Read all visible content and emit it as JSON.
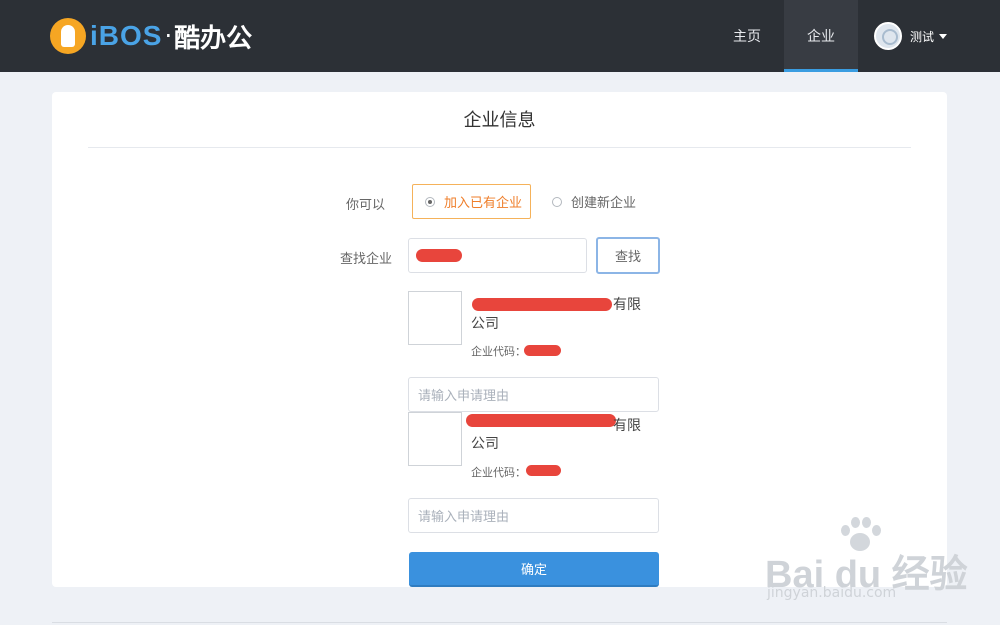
{
  "brand": {
    "name": "iBOS",
    "separator": "·",
    "cn_name": "酷办公"
  },
  "nav": {
    "home": "主页",
    "enterprise": "企业"
  },
  "user": {
    "name": "测试"
  },
  "card": {
    "title": "企业信息"
  },
  "form": {
    "choice_label": "你可以",
    "option_join": "加入已有企业",
    "option_create": "创建新企业",
    "search_label": "查找企业",
    "search_button": "查找",
    "confirm_button": "确定"
  },
  "results": [
    {
      "name_line1": "有限",
      "name_line2": "公司",
      "code_label": "企业代码：",
      "reason_placeholder": "请输入申请理由"
    },
    {
      "name_line1": "有限",
      "name_line2": "公司",
      "code_label": "企业代码：",
      "reason_placeholder": "请输入申请理由"
    }
  ],
  "watermark": {
    "main": "Bai du 经验",
    "sub": "jingyan.baidu.com"
  },
  "colors": {
    "topbar": "#2c3036",
    "accent_blue": "#3a91de",
    "accent_orange": "#ef7e2a",
    "redaction": "#e8453c"
  }
}
